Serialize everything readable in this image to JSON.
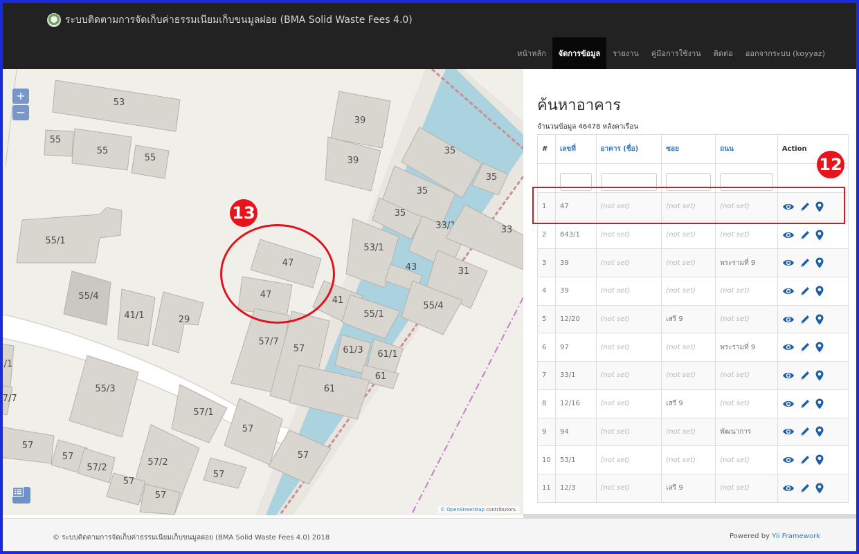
{
  "navbar": {
    "brand": "ระบบติดตามการจัดเก็บค่าธรรมเนียมเก็บขนมูลฝอย (BMA Solid Waste Fees 4.0)",
    "items": [
      {
        "label": "หน้าหลัก",
        "active": false
      },
      {
        "label": "จัดการข้อมูล",
        "active": true
      },
      {
        "label": "รายงาน",
        "active": false
      },
      {
        "label": "คู่มือการใช้งาน",
        "active": false
      },
      {
        "label": "ติดต่อ",
        "active": false
      },
      {
        "label": "ออกจากระบบ (koyyaz)",
        "active": false
      }
    ]
  },
  "map": {
    "zoom_in": "+",
    "zoom_out": "−",
    "attribution_link": "© OpenStreetMap",
    "attribution_text": "contributors.",
    "building_labels": [
      "53",
      "39",
      "55",
      "55",
      "55",
      "39",
      "35",
      "35",
      "35",
      "35",
      "33/1",
      "33",
      "55/1",
      "53/1",
      "47",
      "43",
      "31",
      "55/4",
      "47",
      "41",
      "55/1",
      "55/4",
      "41/1",
      "29",
      "57/7",
      "57",
      "61/3",
      "61/1",
      "/1",
      "61",
      "55/3",
      "61",
      "57/7",
      "57/1",
      "57",
      "57",
      "57",
      "57/2",
      "57/2",
      "57",
      "57",
      "57",
      "57"
    ]
  },
  "panel": {
    "title": "ค้นหาอาคาร",
    "summary": "จำนวนข้อมูล 46478 หลังคาเรือน",
    "columns": [
      "#",
      "เลขที่",
      "อาคาร (ชื่อ)",
      "ซอย",
      "ถนน",
      "Action"
    ],
    "rows": [
      [
        "1",
        "47",
        "(not set)",
        "(not set)",
        "(not set)"
      ],
      [
        "2",
        "843/1",
        "(not set)",
        "(not set)",
        "(not set)"
      ],
      [
        "3",
        "39",
        "(not set)",
        "(not set)",
        "พระรามที่ 9"
      ],
      [
        "4",
        "39",
        "(not set)",
        "(not set)",
        "(not set)"
      ],
      [
        "5",
        "12/20",
        "(not set)",
        "เสรี 9",
        "(not set)"
      ],
      [
        "6",
        "97",
        "(not set)",
        "(not set)",
        "พระรามที่ 9"
      ],
      [
        "7",
        "33/1",
        "(not set)",
        "(not set)",
        "(not set)"
      ],
      [
        "8",
        "12/16",
        "(not set)",
        "เสรี 9",
        "(not set)"
      ],
      [
        "9",
        "94",
        "(not set)",
        "(not set)",
        "พัฒนาการ"
      ],
      [
        "10",
        "53/1",
        "(not set)",
        "(not set)",
        "(not set)"
      ],
      [
        "11",
        "12/3",
        "(not set)",
        "เสรี 9",
        "(not set)"
      ]
    ],
    "icons": [
      "eye-icon",
      "pencil-icon",
      "map-marker-icon"
    ]
  },
  "footer": {
    "left": "© ระบบติดตามการจัดเก็บค่าธรรมเนียมเก็บขนมูลฝอย (BMA Solid Waste Fees 4.0) 2018",
    "right_prefix": "Powered by",
    "right_link": "Yii Framework"
  },
  "annotations": {
    "badge_12": "12",
    "badge_13": "13"
  },
  "colors": {
    "navbar": "#222222",
    "link": "#337ab7",
    "annotation": "#e0141e",
    "frame": "#1a2adf",
    "icon": "#1f5fa8"
  }
}
